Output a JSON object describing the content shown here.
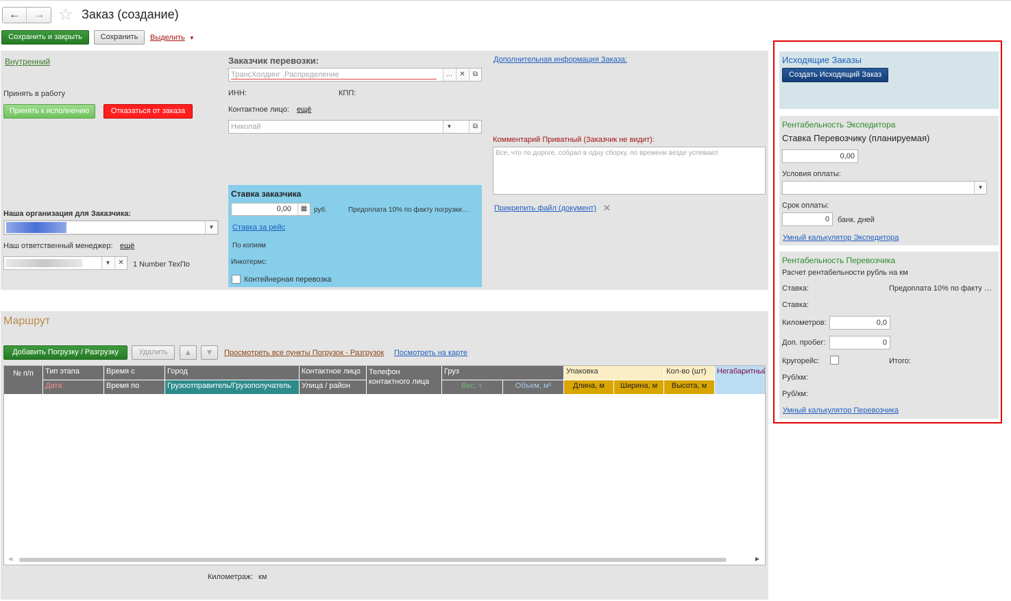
{
  "header": {
    "title": "Заказ (создание)"
  },
  "toolbar": {
    "save_close": "Сохранить и закрыть",
    "save": "Сохранить",
    "select": "Выделить"
  },
  "left": {
    "internal_link": "Внутренний",
    "accept_label": "Принять в работу",
    "accept_button": "Принять к исполнению",
    "reject_button": "Отказаться от заказа",
    "our_org_label": "Наша организация для Заказчика:",
    "manager_label": "Наш ответственный менеджер:",
    "manager_more": "ещё",
    "manager_extra": "1 Number ТехПо"
  },
  "customer": {
    "title": "Заказчик перевозки:",
    "value": "ТрансХолдинг ,Распределение",
    "inn_label": "ИНН:",
    "kpp_label": "КПП:",
    "contact_label": "Контактное лицо:",
    "contact_more": "ещё",
    "contact_value": "Николай"
  },
  "rate": {
    "title": "Ставка заказчика",
    "value": "0,00",
    "currency": "руб.",
    "prepay": "Предоплата 10% по факту погрузки…",
    "per_trip": "Ставка за рейс",
    "by_copies": "По копиям",
    "incoterms": "Инкотермс:",
    "container": "Контейнерная перевозка"
  },
  "extra": {
    "info_link": "Дополнительная информация Заказа:",
    "comment_label": "Комментарий Приватный (Заказчик не видит):",
    "comment_placeholder": "Все, что по дороге, собрал в одну сборку, по времени везде успевают",
    "attach_link": "Прикрепить файл (документ)"
  },
  "route": {
    "title": "Маршрут",
    "add_button": "Добавить Погрузку / Разгрузку",
    "delete_button": "Удалить",
    "view_all_link": "Просмотреть все пункты Погрузок - Разгрузок",
    "map_link": "Посмотреть на карте",
    "mileage_label": "Километраж:",
    "mileage_unit": "км"
  },
  "table": {
    "h_num": "№ п/п",
    "h_stage": "Тип этапа",
    "h_date": "Дата",
    "h_time_from": "Время с",
    "h_time_to": "Время по",
    "h_city": "Город",
    "h_shipper": "Грузоотправитель/Грузополучатель",
    "h_contact": "Контактное лицо",
    "h_street": "Улица / район",
    "h_phone": "Телефон контактного лица",
    "h_cargo": "Груз",
    "h_weight": "Вес, т.",
    "h_volume": "Объем, м³",
    "h_pack": "Упаковка",
    "h_length": "Длина, м",
    "h_width": "Ширина, м",
    "h_qty": "Кол-во (шт)",
    "h_height": "Высота, м",
    "h_oversize": "Негабаритный"
  },
  "right": {
    "outgoing_title": "Исходящие Заказы",
    "create_outgoing": "Создать Исходящий Заказ",
    "forwarder_title": "Рентабельность Экспедитора",
    "carrier_rate_planned": "Ставка Перевозчику (планируемая)",
    "planned_value": "0,00",
    "pay_terms_label": "Условия оплаты:",
    "pay_term_label": "Срок оплаты:",
    "pay_term_value": "0",
    "bank_days": "банк. дней",
    "smart_calc_forwarder": "Умный калькулятор Экспедитора",
    "carrier_title": "Рентабельность Перевозчика",
    "calc_label": "Расчет рентабельности рубль на км",
    "rate_label_1": "Ставка:",
    "rate_value_1": "Предоплата 10% по факту …",
    "rate_label_2": "Ставка:",
    "km_label": "Километров:",
    "km_value": "0,0",
    "extra_run_label": "Доп. пробег:",
    "extra_run_value": "0",
    "round_trip_label": "Кругорейс:",
    "total_label": "Итого:",
    "rub_km_1": "Руб/км:",
    "rub_km_2": "Руб/км:",
    "smart_calc_carrier": "Умный калькулятор Перевозчика"
  },
  "colors": {
    "highlight_border": "#e00000",
    "rate_panel": "#87ceeb",
    "outgoing_panel": "#d5e4e8"
  }
}
